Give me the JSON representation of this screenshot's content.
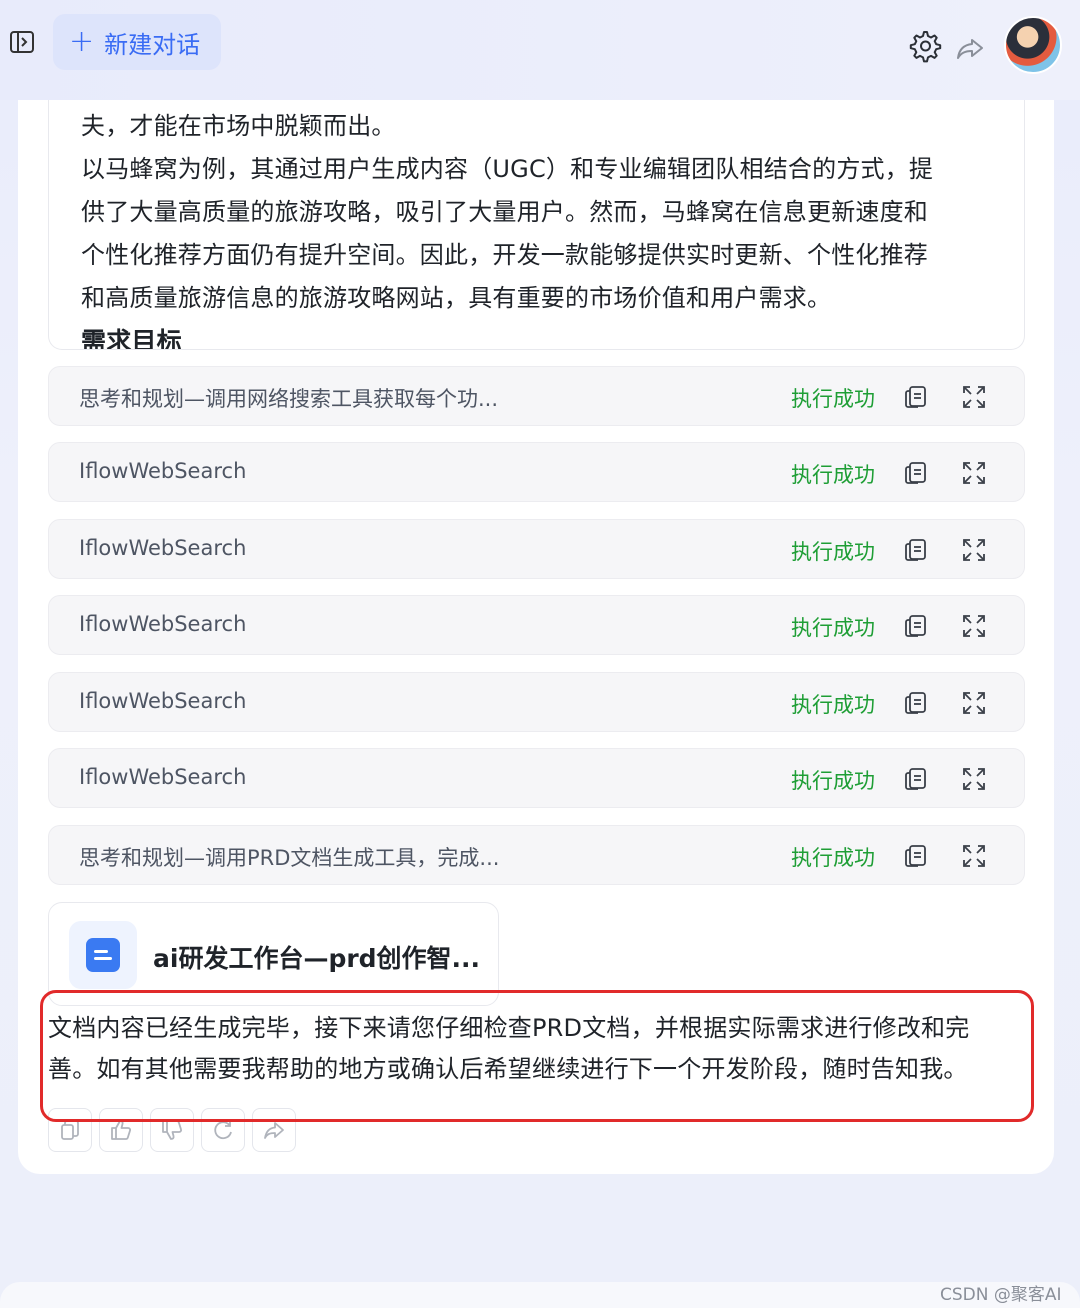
{
  "header": {
    "new_chat_label": "新建对话"
  },
  "document": {
    "lines": [
      "夫，才能在市场中脱颖而出。",
      "以马蜂窝为例，其通过用户生成内容（UGC）和专业编辑团队相结合的方式，提",
      "供了大量高质量的旅游攻略，吸引了大量用户。然而，马蜂窝在信息更新速度和",
      "个性化推荐方面仍有提升空间。因此，开发一款能够提供实时更新、个性化推荐",
      "和高质量旅游信息的旅游攻略网站，具有重要的市场价值和用户需求。"
    ],
    "heading": "需求目标"
  },
  "tool_calls": [
    {
      "name": "思考和规划—调用网络搜索工具获取每个功...",
      "status": "执行成功"
    },
    {
      "name": "IflowWebSearch",
      "status": "执行成功"
    },
    {
      "name": "IflowWebSearch",
      "status": "执行成功"
    },
    {
      "name": "IflowWebSearch",
      "status": "执行成功"
    },
    {
      "name": "IflowWebSearch",
      "status": "执行成功"
    },
    {
      "name": "IflowWebSearch",
      "status": "执行成功"
    },
    {
      "name": "思考和规划—调用PRD文档生成工具，完成...",
      "status": "执行成功"
    }
  ],
  "file_card": {
    "title": "ai研发工作台—prd创作智..."
  },
  "answer": {
    "lines": [
      "文档内容已经生成完毕，接下来请您仔细检查PRD文档，并根据实际需求进行修改和完",
      "善。如有其他需要我帮助的地方或确认后希望继续进行下一个开发阶段，随时告知我。"
    ]
  },
  "actions": [
    "copy-icon",
    "thumbs-up-icon",
    "thumbs-down-icon",
    "refresh-icon",
    "share-icon"
  ],
  "colors": {
    "accent": "#3a6cf4",
    "success": "#1e9e35",
    "highlight": "#e12a2a"
  },
  "watermark": "CSDN @聚客AI"
}
